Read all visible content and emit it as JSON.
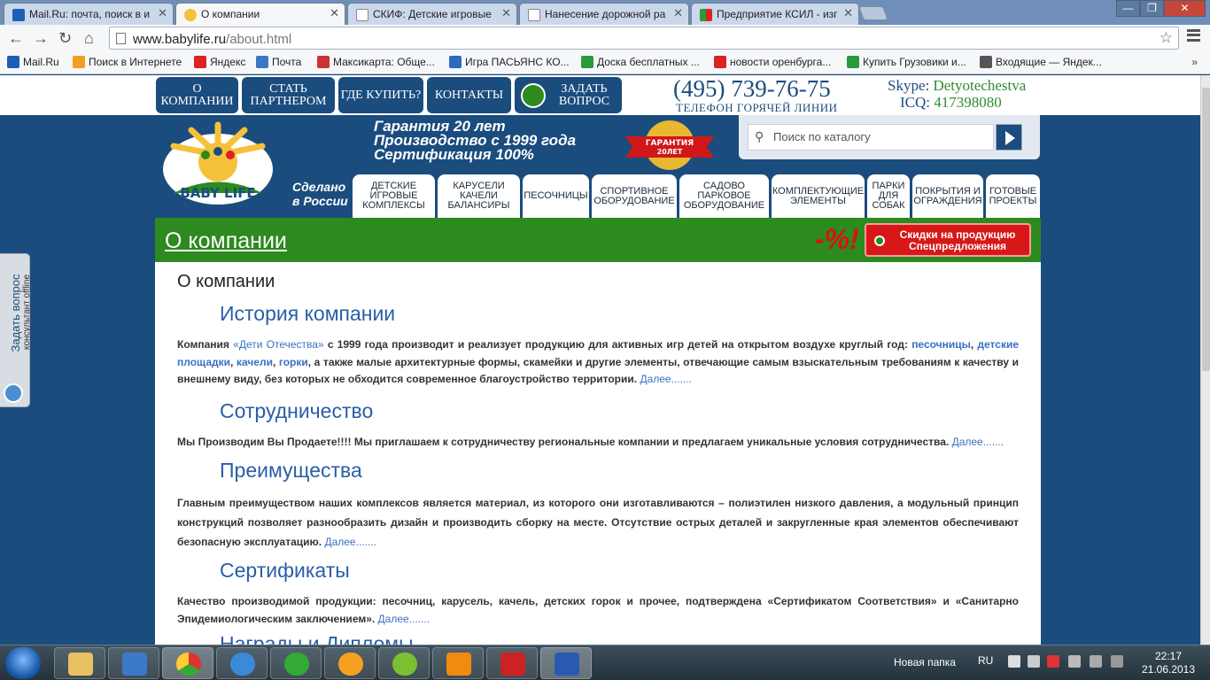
{
  "browser": {
    "tabs": [
      {
        "label": "Mail.Ru: почта, поиск в и",
        "active": false,
        "icon": "mailru-icon"
      },
      {
        "label": "О компании",
        "active": true,
        "icon": "babylife-icon"
      },
      {
        "label": "СКИФ: Детские игровые",
        "active": false,
        "icon": "page-icon"
      },
      {
        "label": "Нанесение дорожной ра",
        "active": false,
        "icon": "page-icon"
      },
      {
        "label": "Предприятие КСИЛ - изг",
        "active": false,
        "icon": "ksil-icon"
      }
    ],
    "url_host": "www.babylife.ru",
    "url_path": "/about.html",
    "bookmarks": [
      {
        "label": "Mail.Ru",
        "color": "#1e5fb4"
      },
      {
        "label": "Поиск в Интернете",
        "color": "#f0a020"
      },
      {
        "label": "Яндекс",
        "color": "#d22"
      },
      {
        "label": "Почта",
        "color": "#3a78c4"
      },
      {
        "label": "Максикарта: Обще...",
        "color": "#c33"
      },
      {
        "label": "Игра ПАСЬЯНС КО...",
        "color": "#2a6ac0"
      },
      {
        "label": "Доска бесплатных ...",
        "color": "#2a9a3a"
      },
      {
        "label": "новости оренбурга...",
        "color": "#d22"
      },
      {
        "label": "Купить Грузовики и...",
        "color": "#2a9a3a"
      },
      {
        "label": "Входящие — Яндек...",
        "color": "#555"
      }
    ],
    "bookmarks_more": "»"
  },
  "site": {
    "top_nav": [
      {
        "label": "О компании"
      },
      {
        "label": "Стать партнером"
      },
      {
        "label": "Где купить?"
      },
      {
        "label": "Контакты"
      },
      {
        "label": "Задать вопрос"
      }
    ],
    "phone": "(495) 739-76-75",
    "phone_label": "ТЕЛЕФОН ГОРЯЧЕЙ ЛИНИИ",
    "skype_label": "Skype:",
    "skype_value": "Detyotechestva",
    "icq_label": "ICQ:",
    "icq_value": "417398080",
    "logo_text": "BABY LIFE",
    "made_in_1": "Сделано",
    "made_in_2": "в России",
    "slogans": [
      "Гарантия 20 лет",
      "Производство с 1999 года",
      "Сертификация 100%"
    ],
    "badge_line1": "ГАРАНТИЯ",
    "badge_line2": "20ЛЕТ",
    "search_placeholder": "Поиск по каталогу",
    "categories": [
      "Детские игровые комплексы",
      "Карусели качели балансиры",
      "Песочницы",
      "Спортивное оборудование",
      "Садово парковое оборудование",
      "Комплектующие элементы",
      "Парки для собак",
      "Покрытия и ограждения",
      "Готовые проекты"
    ],
    "page_title": "О компании",
    "promo_pct": "-%!",
    "promo_line1": "Скидки на продукцию",
    "promo_line2": "Спецпредложения",
    "heading": "О компании",
    "more": "Далее.......",
    "sections": [
      {
        "title": "История компании"
      },
      {
        "title": "Сотрудничество"
      },
      {
        "title": "Преимущества"
      },
      {
        "title": "Сертификаты"
      },
      {
        "title": "Награды и Дипломы"
      }
    ],
    "history": {
      "t1": "Компания ",
      "link1": "«Дети Отечества»",
      "t2": " с 1999 года производит и реализует продукцию для активных игр детей на открытом воздухе круглый год: ",
      "link2": "песочницы",
      "sep1": ", ",
      "link3": "детские площадки",
      "sep2": ", ",
      "link4": "качели",
      "sep3": ", ",
      "link5": "горки",
      "t3": ", а также малые архитектурные формы, скамейки и другие элементы, отвечающие  самым взыскательным требованиям к качеству и внешнему виду, без которых не обходится современное благоустройство территории. "
    },
    "coop": "Мы Производим Вы Продаете!!!!  Мы приглашаем к сотрудничеству региональные компании и предлагаем уникальные условия сотрудничества. ",
    "adv": "Главным преимуществом наших комплексов является материал, из которого они изготавливаются – полиэтилен низкого давления, а модульный принцип конструкций позволяет разнообразить дизайн и производить сборку на месте. Отсутствие острых деталей и закругленные края элементов обеспечивают безопасную эксплуатацию. ",
    "cert": "Качество производимой продукции: песочниц, карусель, качель, детских горок и прочее, подтверждена «Сертификатом Соответствия» и «Санитарно Эпидемиологическим заключением». ",
    "side_button_1": "Задать вопрос",
    "side_button_2": "консультант offline"
  },
  "taskbar": {
    "new_folder": "Новая папка",
    "lang": "RU",
    "time": "22:17",
    "date": "21.06.2013"
  }
}
